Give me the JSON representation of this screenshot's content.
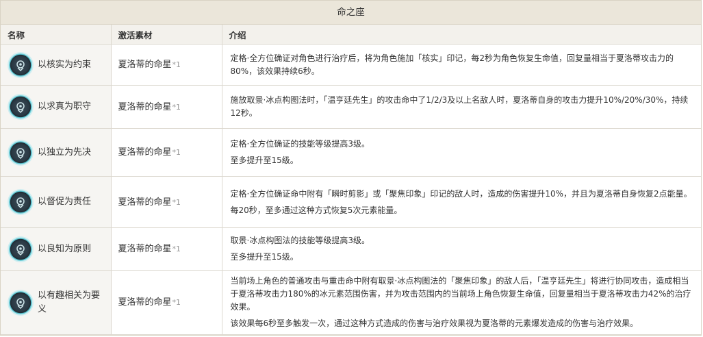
{
  "title": "命之座",
  "headers": {
    "name": "名称",
    "material": "激活素材",
    "desc": "介绍"
  },
  "rows": [
    {
      "name": "以核实为约束",
      "material": "夏洛蒂的命星",
      "count": "*1",
      "icon": "constellation-icon",
      "desc": [
        "定格·全方位确证对角色进行治疗后，将为角色施加「核实」印记，每2秒为角色恢复生命值，回复量相当于夏洛蒂攻击力的80%，该效果持续6秒。"
      ]
    },
    {
      "name": "以求真为职守",
      "material": "夏洛蒂的命星",
      "count": "*1",
      "icon": "constellation-icon",
      "desc": [
        "施放取景·冰点构图法时，「温亨廷先生」的攻击命中了1/2/3及以上名敌人时，夏洛蒂自身的攻击力提升10%/20%/30%，持续12秒。"
      ]
    },
    {
      "name": "以独立为先决",
      "material": "夏洛蒂的命星",
      "count": "*1",
      "icon": "constellation-icon",
      "desc": [
        "定格·全方位确证的技能等级提高3级。",
        "至多提升至15级。"
      ]
    },
    {
      "name": "以督促为责任",
      "material": "夏洛蒂的命星",
      "count": "*1",
      "icon": "constellation-icon",
      "desc": [
        "定格·全方位确证命中附有「瞬时剪影」或「聚焦印象」印记的敌人时，造成的伤害提升10%，并且为夏洛蒂自身恢复2点能量。",
        "每20秒，至多通过这种方式恢复5次元素能量。"
      ]
    },
    {
      "name": "以良知为原则",
      "material": "夏洛蒂的命星",
      "count": "*1",
      "icon": "constellation-icon",
      "desc": [
        "取景·冰点构图法的技能等级提高3级。",
        "至多提升至15级。"
      ]
    },
    {
      "name": "以有趣相关为要义",
      "material": "夏洛蒂的命星",
      "count": "*1",
      "icon": "constellation-icon",
      "desc": [
        "当前场上角色的普通攻击与重击命中附有取景·冰点构图法的「聚焦印象」的敌人后，「温亨廷先生」将进行协同攻击，造成相当于夏洛蒂攻击力180%的冰元素范围伤害，并为攻击范围内的当前场上角色恢复生命值，回复量相当于夏洛蒂攻击力42%的治疗效果。",
        "该效果每6秒至多触发一次，通过这种方式造成的伤害与治疗效果视为夏洛蒂的元素爆发造成的伤害与治疗效果。"
      ]
    }
  ]
}
